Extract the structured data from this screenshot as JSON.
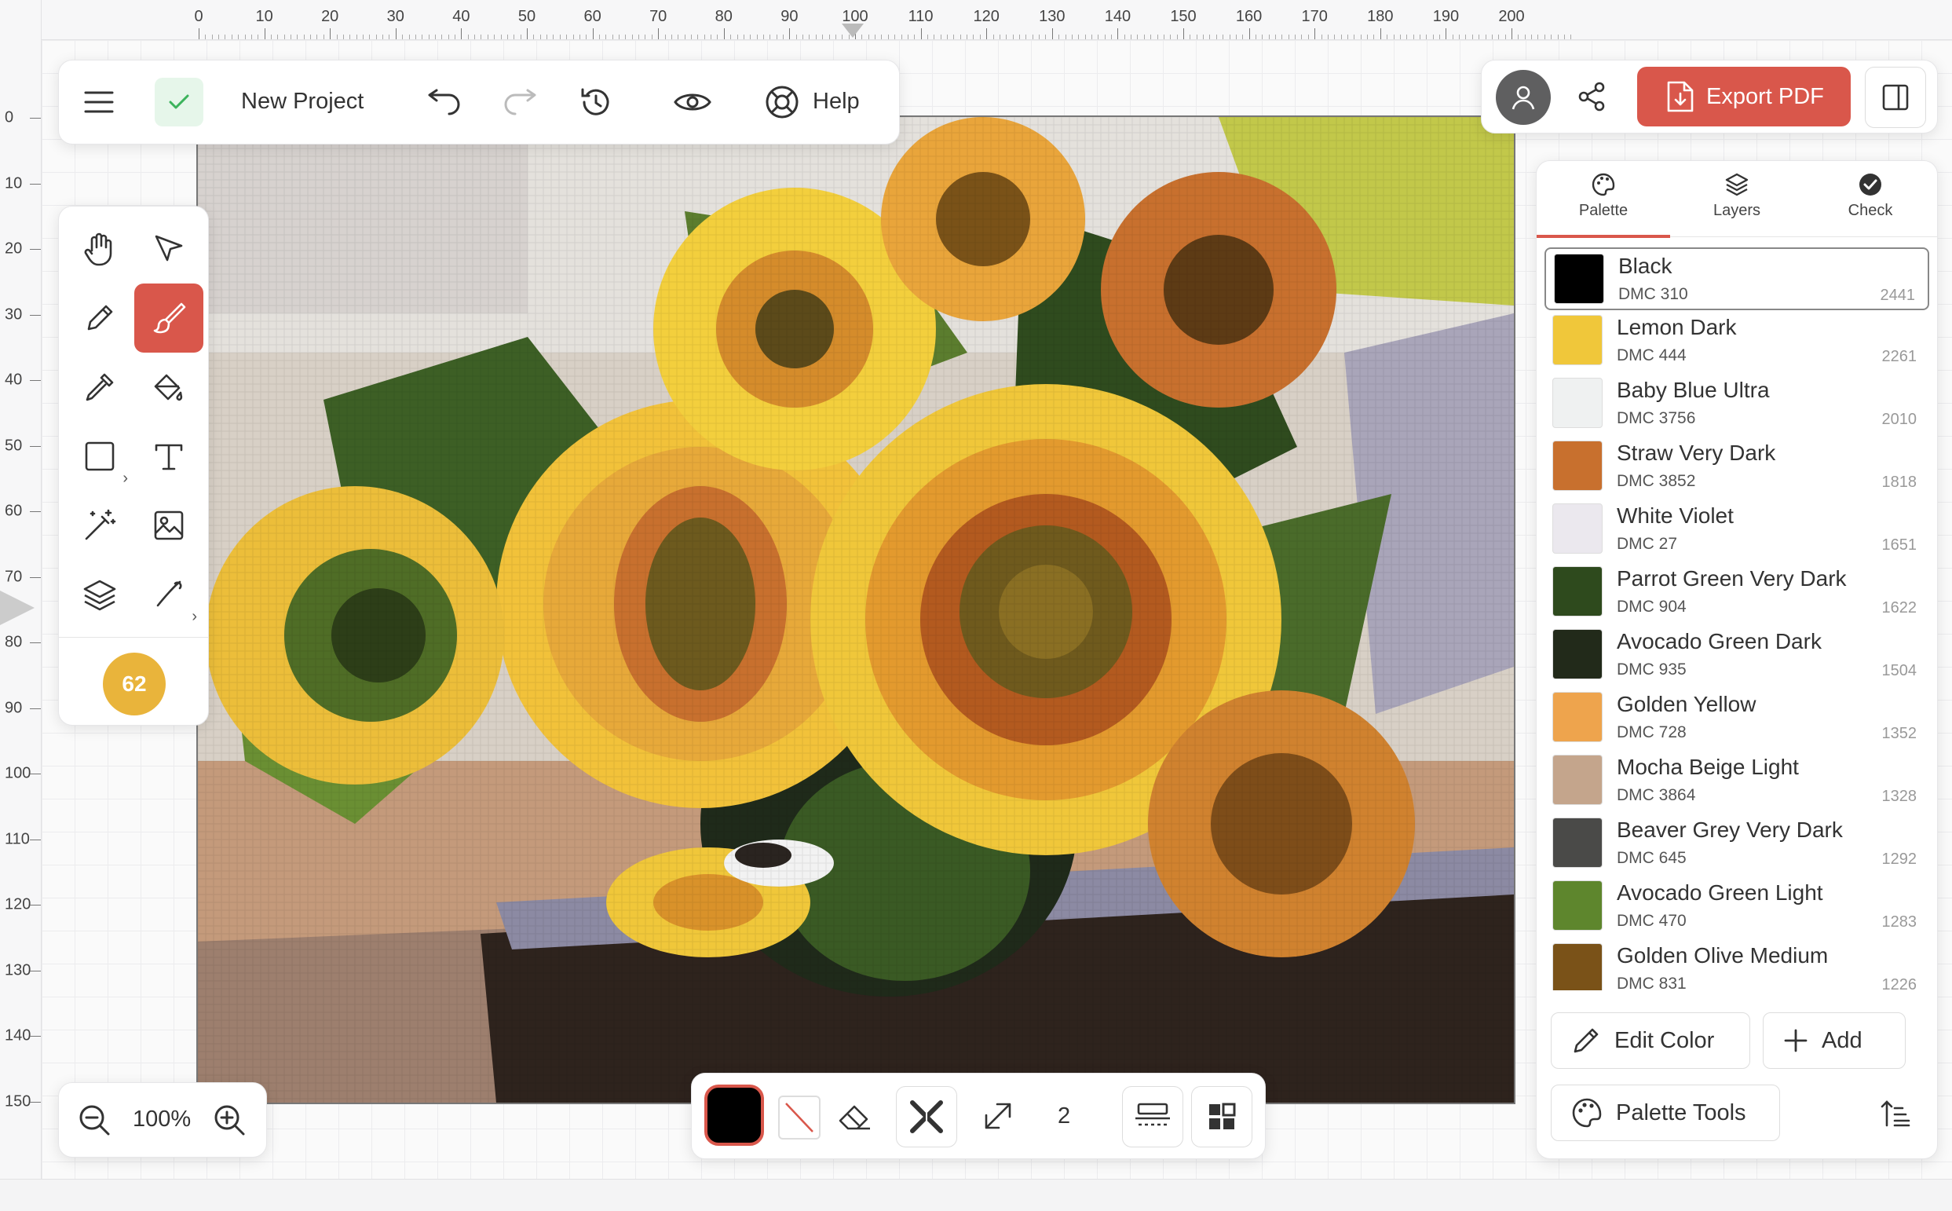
{
  "ruler": {
    "top_labels": [
      "0",
      "10",
      "20",
      "30",
      "40",
      "50",
      "60",
      "70",
      "80",
      "90",
      "100",
      "110",
      "120",
      "130",
      "140",
      "150",
      "160",
      "170",
      "180",
      "190",
      "200"
    ],
    "left_labels": [
      "0",
      "10",
      "20",
      "30",
      "40",
      "50",
      "60",
      "70",
      "80",
      "90",
      "100",
      "110",
      "120",
      "130",
      "140",
      "150"
    ]
  },
  "topbar": {
    "project_title": "New Project",
    "help_label": "Help"
  },
  "toolbar": {
    "color_count": "62"
  },
  "zoom": {
    "value": "100%"
  },
  "bottombar": {
    "stitch_size": "2"
  },
  "header_right": {
    "export_label": "Export PDF"
  },
  "tabs": [
    {
      "label": "Palette"
    },
    {
      "label": "Layers"
    },
    {
      "label": "Check"
    }
  ],
  "palette": [
    {
      "name": "Black",
      "code": "DMC 310",
      "count": "2441",
      "color": "#000000"
    },
    {
      "name": "Lemon Dark",
      "code": "DMC 444",
      "count": "2261",
      "color": "#f0c73a"
    },
    {
      "name": "Baby Blue Ultra",
      "code": "DMC 3756",
      "count": "2010",
      "color": "#eff1f1"
    },
    {
      "name": "Straw Very Dark",
      "code": "DMC 3852",
      "count": "1818",
      "color": "#c8702e"
    },
    {
      "name": "White Violet",
      "code": "DMC 27",
      "count": "1651",
      "color": "#ebe8ee"
    },
    {
      "name": "Parrot Green Very Dark",
      "code": "DMC 904",
      "count": "1622",
      "color": "#2e4a1d"
    },
    {
      "name": "Avocado Green Dark",
      "code": "DMC 935",
      "count": "1504",
      "color": "#222a1a"
    },
    {
      "name": "Golden Yellow",
      "code": "DMC 728",
      "count": "1352",
      "color": "#eea44d"
    },
    {
      "name": "Mocha Beige Light",
      "code": "DMC 3864",
      "count": "1328",
      "color": "#c4a58c"
    },
    {
      "name": "Beaver Grey Very Dark",
      "code": "DMC 645",
      "count": "1292",
      "color": "#4a4a48"
    },
    {
      "name": "Avocado Green Light",
      "code": "DMC 470",
      "count": "1283",
      "color": "#5e862d"
    },
    {
      "name": "Golden Olive Medium",
      "code": "DMC 831",
      "count": "1226",
      "color": "#7a5218"
    }
  ],
  "panel_buttons": {
    "edit_color": "Edit Color",
    "add": "Add",
    "palette_tools": "Palette Tools"
  },
  "colors": {
    "accent": "#d9574b",
    "badge": "#e9b43b",
    "success": "#3cb35c"
  }
}
